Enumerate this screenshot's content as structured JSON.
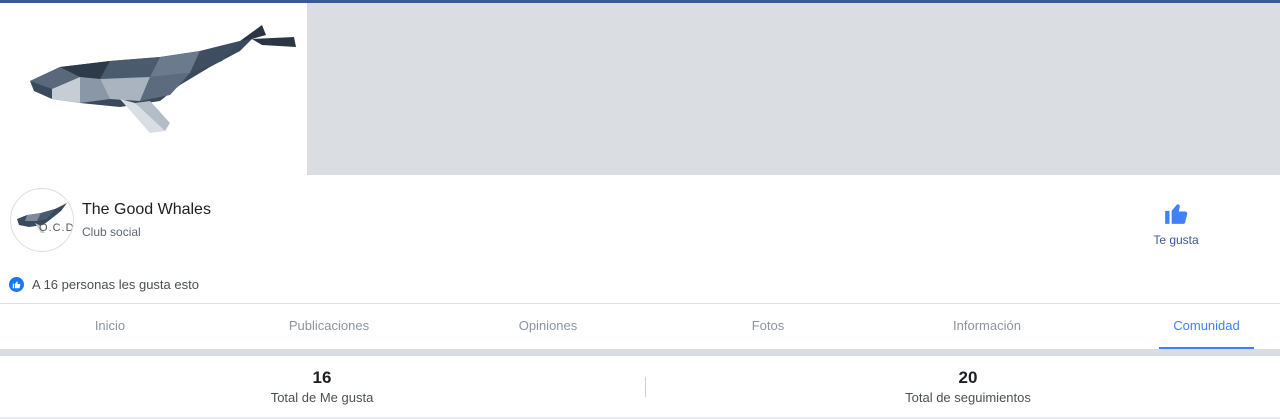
{
  "page": {
    "name": "The Good Whales",
    "category": "Club social",
    "logo_text": "O.C.D"
  },
  "like_button": {
    "label": "Te gusta",
    "icon": "thumbs-up-icon"
  },
  "likes_summary": "A 16 personas les gusta esto",
  "tabs": [
    {
      "label": "Inicio",
      "active": false
    },
    {
      "label": "Publicaciones",
      "active": false
    },
    {
      "label": "Opiniones",
      "active": false
    },
    {
      "label": "Fotos",
      "active": false
    },
    {
      "label": "Información",
      "active": false
    },
    {
      "label": "Comunidad",
      "active": true
    }
  ],
  "stats": {
    "likes": {
      "value": "16",
      "label": "Total de Me gusta"
    },
    "follows": {
      "value": "20",
      "label": "Total de seguimientos"
    }
  },
  "colors": {
    "brand": "#3b5998",
    "accent": "#4080ff",
    "like_blue": "#1877f2",
    "cover_gray": "#dadde1"
  }
}
